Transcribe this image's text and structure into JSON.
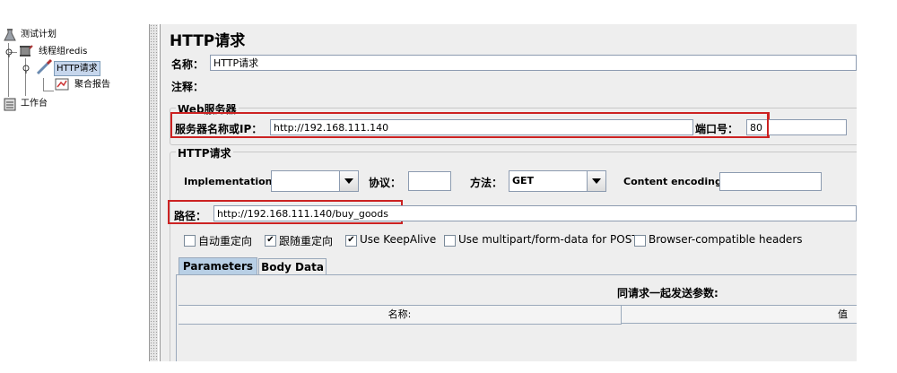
{
  "tree": {
    "test_plan": "测试计划",
    "thread_group": "线程组redis",
    "http_request": "HTTP请求",
    "aggregate_report": "聚合报告",
    "workbench": "工作台"
  },
  "panel": {
    "title": "HTTP请求",
    "name_label": "名称：",
    "name_value": "HTTP请求",
    "comment_label": "注释：",
    "comment_value": ""
  },
  "web_server": {
    "legend": "Web服务器",
    "server_label": "服务器名称或IP：",
    "server_value": "http://192.168.111.140",
    "port_label": "端口号：",
    "port_value": "80"
  },
  "http_request": {
    "legend": "HTTP请求",
    "implementation_label": "Implementation:",
    "implementation_value": "",
    "protocol_label": "协议：",
    "protocol_value": "",
    "method_label": "方法：",
    "method_value": "GET",
    "encoding_label": "Content encoding:",
    "encoding_value": "",
    "path_label": "路径：",
    "path_value": "http://192.168.111.140/buy_goods"
  },
  "options": [
    {
      "label": "自动重定向",
      "checked": false
    },
    {
      "label": "跟随重定向",
      "checked": true
    },
    {
      "label": "Use KeepAlive",
      "checked": true
    },
    {
      "label": "Use multipart/form-data for POST",
      "checked": false
    },
    {
      "label": "Browser-compatible headers",
      "checked": false
    }
  ],
  "tabs": {
    "parameters": "Parameters",
    "body_data": "Body Data"
  },
  "params_table": {
    "caption": "同请求一起发送参数:",
    "col_name": "名称:",
    "col_value": "值"
  },
  "colors": {
    "highlight": "#cc2222",
    "selection": "#c6d6ec",
    "tab_active": "#b8cfe5"
  }
}
